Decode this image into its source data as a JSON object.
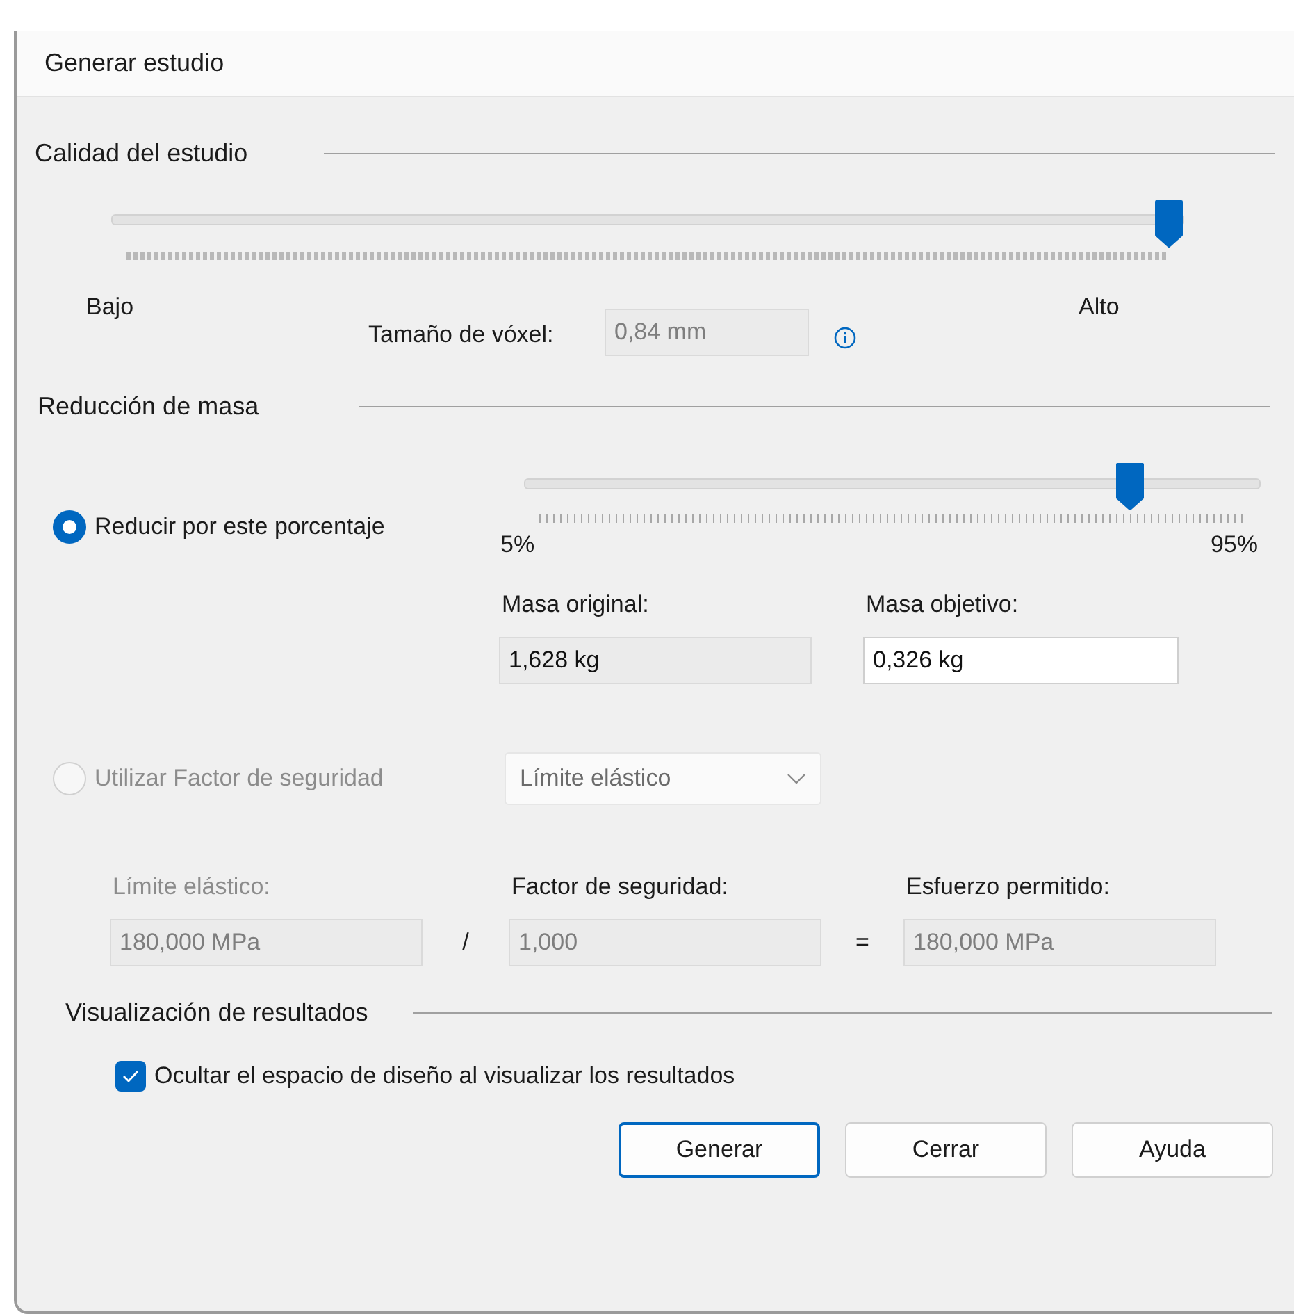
{
  "window": {
    "title": "Generar estudio"
  },
  "study_quality": {
    "title": "Calidad del estudio",
    "slider": {
      "level": 1.0
    },
    "min_label": "Bajo",
    "max_label": "Alto",
    "voxel_size": {
      "label": "Tamaño de vóxel:",
      "value": "0,84 mm",
      "disabled": true
    }
  },
  "mass_reduction": {
    "title": "Reducción de masa",
    "options": [
      {
        "label": "Reducir por este porcentaje",
        "selected": true,
        "disabled": false
      },
      {
        "label": "Utilizar Factor de seguridad",
        "selected": false,
        "disabled": true
      }
    ],
    "slider": {
      "level": 0.835
    },
    "min_label": "5%",
    "max_label": "95%",
    "fields": [
      {
        "label": "Masa original:",
        "value": "1,628 kg",
        "read_only": true
      },
      {
        "label": "Masa objetivo:",
        "value": "0,326 kg",
        "read_only": false
      }
    ],
    "criterion": {
      "value": "Límite elástico"
    },
    "terms": [
      {
        "label": "Límite elástico:",
        "label_disabled": true,
        "value": "180,000 MPa",
        "disabled": true
      },
      {
        "label": "Factor de seguridad:",
        "label_disabled": false,
        "value": "1,000",
        "disabled": true
      },
      {
        "label": "Esfuerzo permitido:",
        "label_disabled": false,
        "value": "180,000 MPa",
        "disabled": true
      }
    ],
    "operators": [
      "/",
      "="
    ]
  },
  "results": {
    "title": "Visualización de resultados",
    "checkbox": {
      "label": "Ocultar el espacio de diseño al visualizar los resultados",
      "checked": true
    }
  },
  "buttons": [
    {
      "label": "Generar",
      "default": true
    },
    {
      "label": "Cerrar",
      "default": false
    },
    {
      "label": "Ayuda",
      "default": false
    }
  ]
}
